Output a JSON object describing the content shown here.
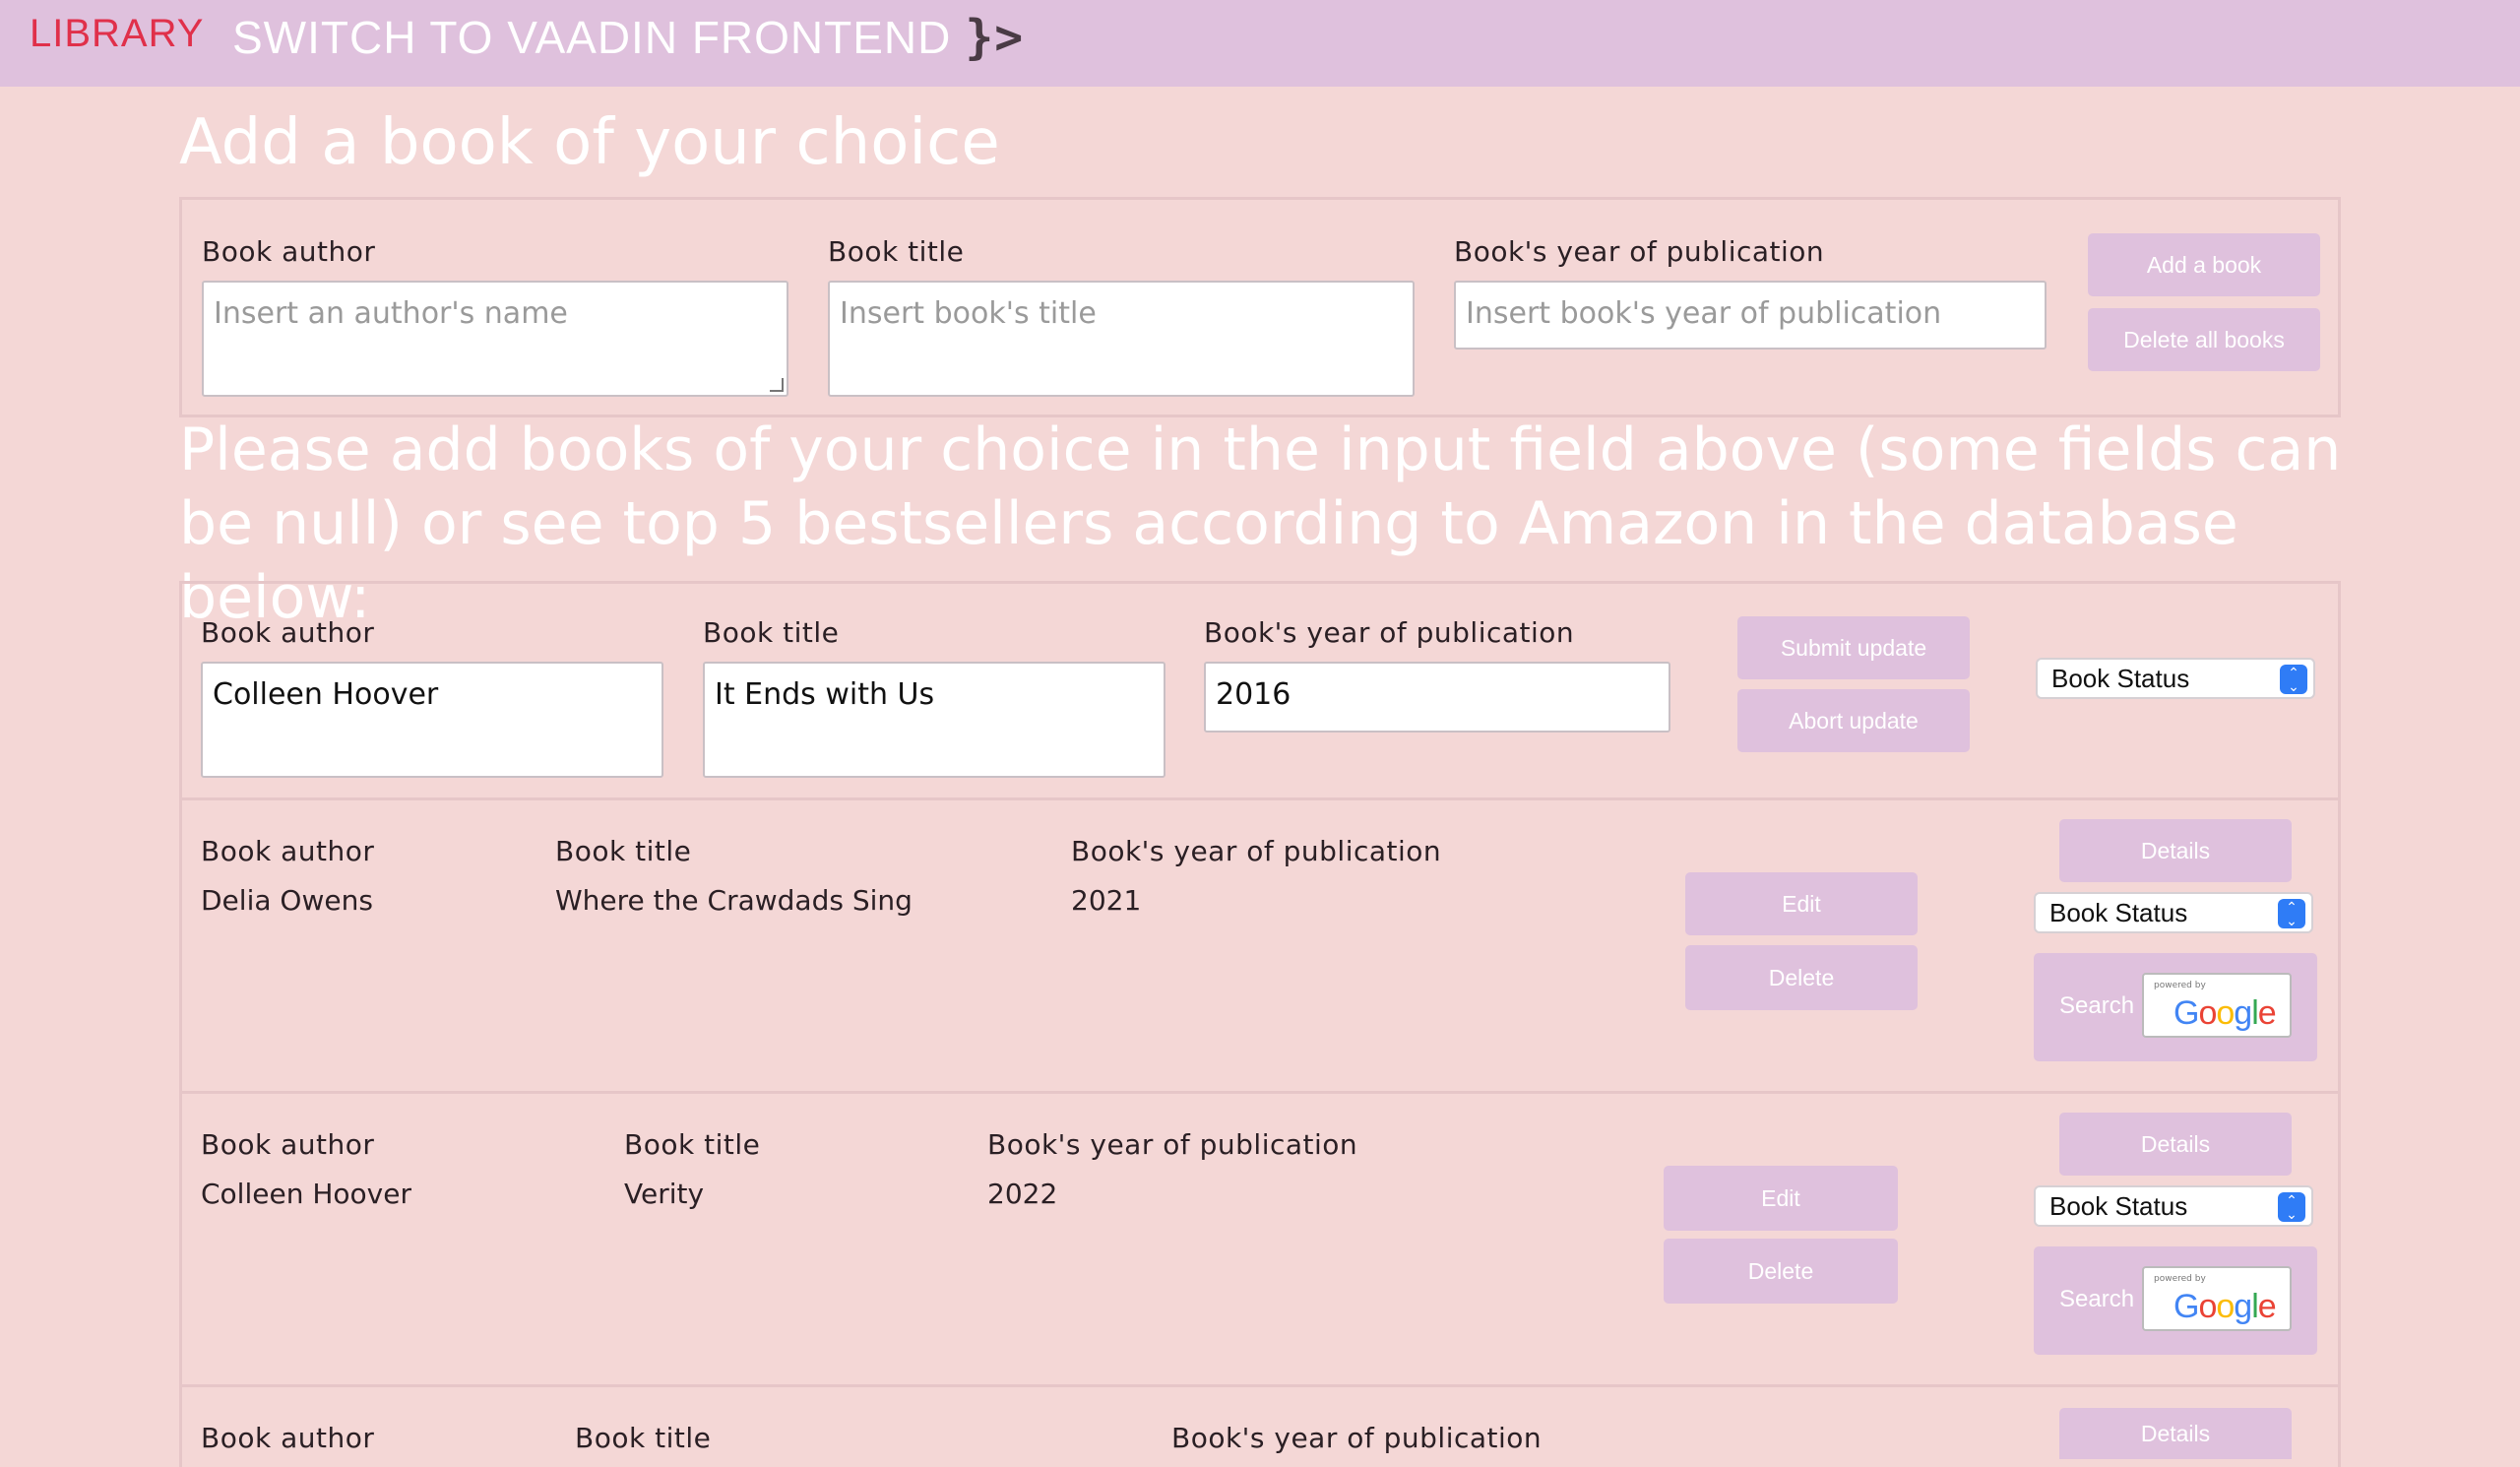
{
  "nav": {
    "brand": "LIBRARY",
    "switch_label": "SWITCH TO VAADIN FRONTEND",
    "vaadin_logo": "}>"
  },
  "add_section": {
    "title": "Add a book of your choice",
    "author_label": "Book author",
    "author_placeholder": "Insert an author's name",
    "title_label": "Book title",
    "title_placeholder": "Insert book's title",
    "year_label": "Book's year of publication",
    "year_placeholder": "Insert book's year of publication",
    "add_button": "Add a book",
    "delete_all_button": "Delete all books"
  },
  "info_text": "Please add books of your choice in the input field above (some fields can be null) or see top 5 bestsellers according to Amazon in the database below:",
  "edit_row": {
    "author_label": "Book author",
    "author_value": "Colleen Hoover",
    "title_label": "Book title",
    "title_value": "It Ends with Us",
    "year_label": "Book's year of publication",
    "year_value": "2016",
    "submit_button": "Submit update",
    "abort_button": "Abort update",
    "status_select": "Book Status"
  },
  "books": [
    {
      "author_label": "Book author",
      "author": "Delia Owens",
      "title_label": "Book title",
      "title": "Where the Crawdads Sing",
      "year_label": "Book's year of publication",
      "year": "2021",
      "details": "Details",
      "edit": "Edit",
      "delete": "Delete",
      "status": "Book Status",
      "search": "Search",
      "powered_by": "powered by",
      "google": "Google"
    },
    {
      "author_label": "Book author",
      "author": "Colleen Hoover",
      "title_label": "Book title",
      "title": "Verity",
      "year_label": "Book's year of publication",
      "year": "2022",
      "details": "Details",
      "edit": "Edit",
      "delete": "Delete",
      "status": "Book Status",
      "search": "Search",
      "powered_by": "powered by",
      "google": "Google"
    },
    {
      "author_label": "Book author",
      "title_label": "Book title",
      "year_label": "Book's year of publication",
      "details": "Details"
    }
  ]
}
